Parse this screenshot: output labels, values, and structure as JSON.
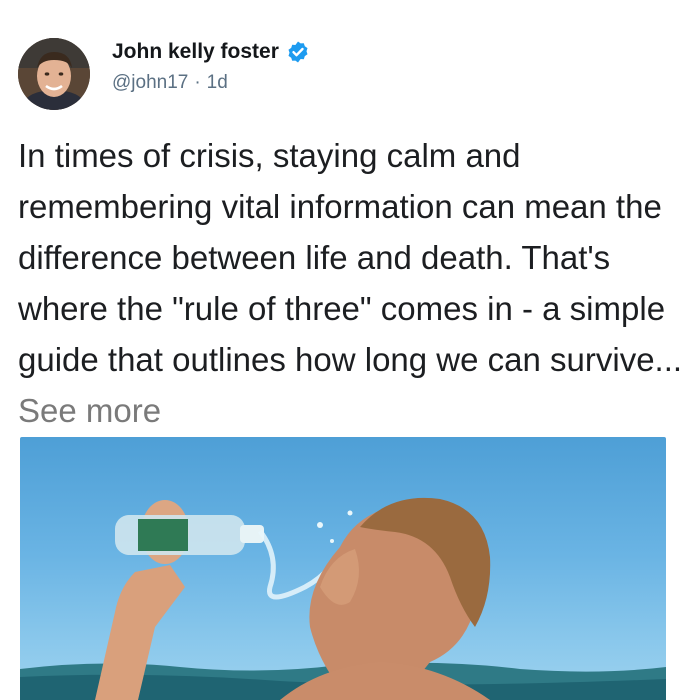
{
  "author": {
    "display_name": "John kelly foster",
    "handle": "@john17",
    "separator": "·",
    "time": "1d",
    "verified": true,
    "verified_color": "#1d9bf0"
  },
  "post": {
    "text": "In times of crisis, staying calm and remembering vital information can mean the difference between life and death. That's where the \"rule of three\" comes in - a simple guide that outlines how long we can survive...",
    "see_more_label": "See more"
  },
  "media": {
    "icon": "photo-of-man-drinking-water-bottle"
  },
  "icons": {
    "avatar": "profile-photo",
    "verified": "verified-badge-icon"
  }
}
